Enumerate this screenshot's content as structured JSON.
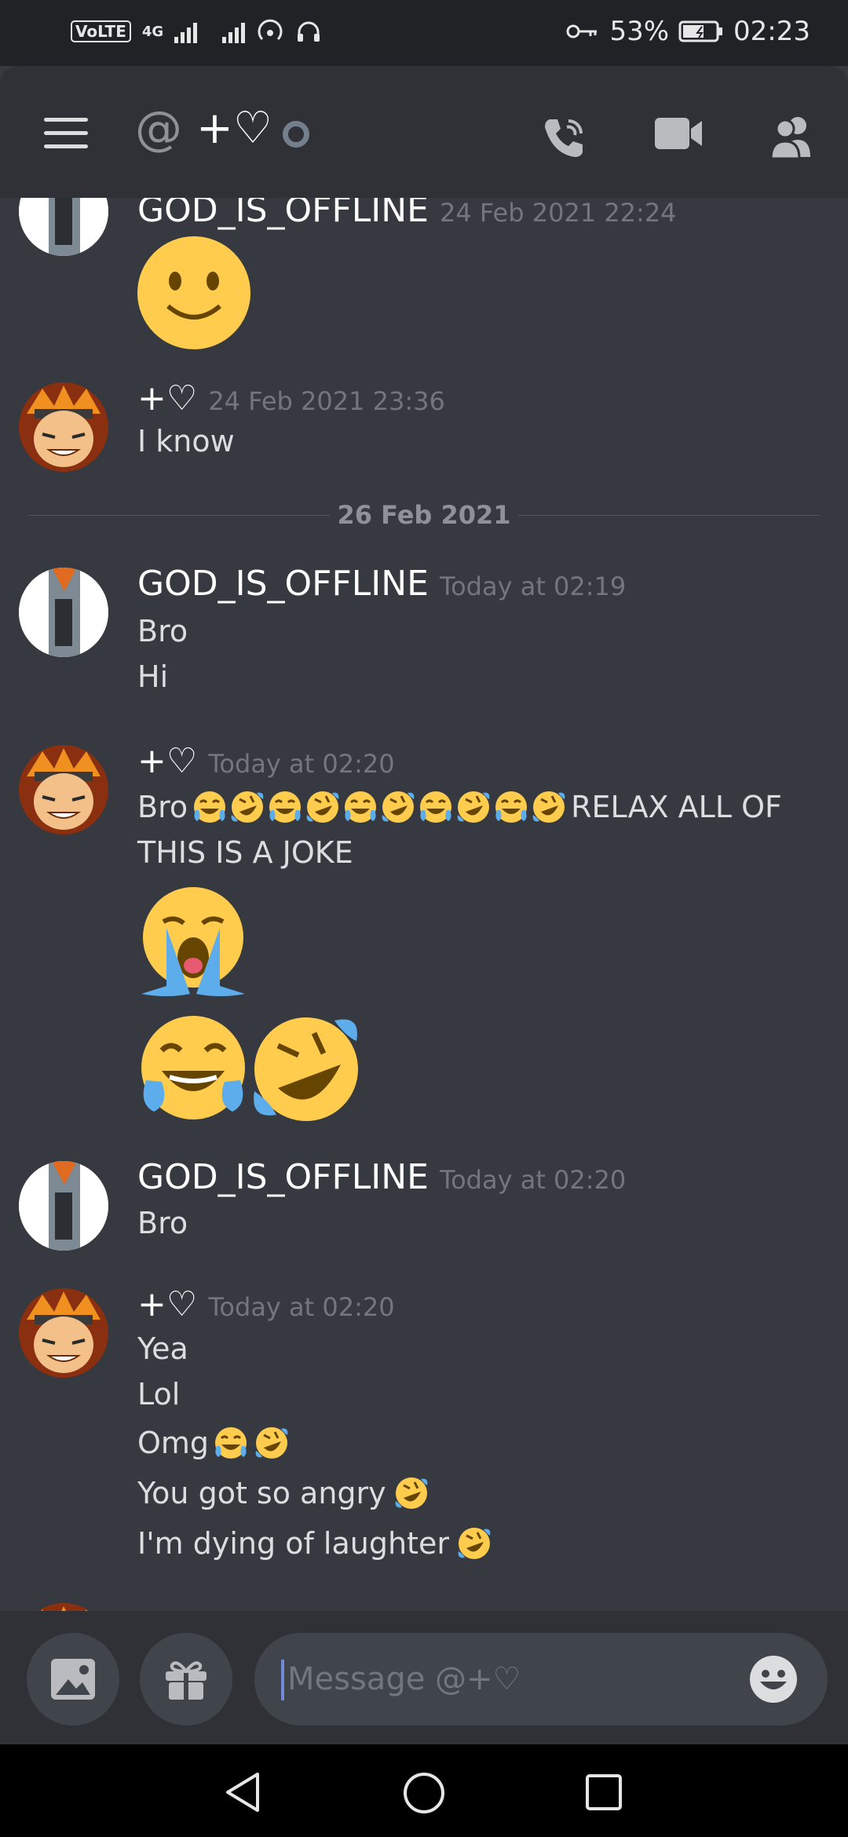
{
  "status_bar": {
    "network_badge": "VoLTE",
    "network_type": "4G",
    "battery": "53%",
    "time": "02:23"
  },
  "header": {
    "title": "+♡",
    "status": "offline",
    "icons": [
      "menu-icon",
      "at-icon",
      "call-icon",
      "video-icon",
      "members-icon"
    ]
  },
  "messages": [
    {
      "author": "GOD_IS_OFFLINE",
      "timestamp": "24 Feb 2021 22:24",
      "lines": [],
      "emoji": [
        "slightly-smiling-face"
      ]
    },
    {
      "author": "+♡",
      "timestamp": "24 Feb 2021 23:36",
      "lines": [
        "I know"
      ]
    },
    {
      "divider": "26 Feb 2021"
    },
    {
      "author": "GOD_IS_OFFLINE",
      "timestamp": "Today at 02:19",
      "lines": [
        "Bro",
        "Hi"
      ]
    },
    {
      "author": "+♡",
      "timestamp": "Today at 02:20",
      "lines": [
        "Bro",
        "RELAX ALL OF",
        "THIS IS A JOKE"
      ],
      "emoji": [
        "loudly-crying-face",
        "joy",
        "rofl"
      ]
    },
    {
      "author": "GOD_IS_OFFLINE",
      "timestamp": "Today at 02:20",
      "lines": [
        "Bro"
      ]
    },
    {
      "author": "+♡",
      "timestamp": "Today at 02:20",
      "lines": [
        "Yea",
        "Lol",
        "Omg",
        "You got so angry",
        "I'm dying of laughter"
      ]
    }
  ],
  "composer": {
    "placeholder": "Message @+♡",
    "icons": [
      "image-icon",
      "gift-icon",
      "emoji-icon"
    ]
  },
  "nav": {
    "icons": [
      "back-icon",
      "home-icon",
      "recents-icon"
    ]
  }
}
